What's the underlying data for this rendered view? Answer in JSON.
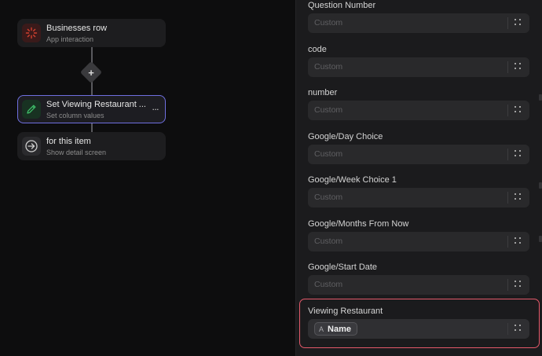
{
  "workflow": {
    "nodes": [
      {
        "title": "Businesses row",
        "subtitle": "App interaction",
        "icon": "spark-icon"
      },
      {
        "title": "Set Viewing Restaurant ...",
        "subtitle": "Set column values",
        "icon": "pencil-icon",
        "selected": true,
        "more_label": "..."
      },
      {
        "title": "for this item",
        "subtitle": "Show detail screen",
        "icon": "arrow-circle-icon"
      }
    ],
    "add_label": "+"
  },
  "panel": {
    "fields": [
      {
        "label": "Question Number",
        "placeholder": "Custom"
      },
      {
        "label": "code",
        "placeholder": "Custom"
      },
      {
        "label": "number",
        "placeholder": "Custom"
      },
      {
        "label": "Google/Day Choice",
        "placeholder": "Custom"
      },
      {
        "label": "Google/Week Choice 1",
        "placeholder": "Custom"
      },
      {
        "label": "Google/Months From Now",
        "placeholder": "Custom"
      },
      {
        "label": "Google/Start Date",
        "placeholder": "Custom"
      }
    ],
    "highlighted_field": {
      "label": "Viewing Restaurant",
      "chip_icon": "A",
      "chip_value": "Name"
    }
  },
  "colors": {
    "selection_border": "#6f6fe0",
    "highlight_border": "#e4596a",
    "panel_bg": "#1b1b1d",
    "canvas_bg": "#0d0d0e"
  }
}
